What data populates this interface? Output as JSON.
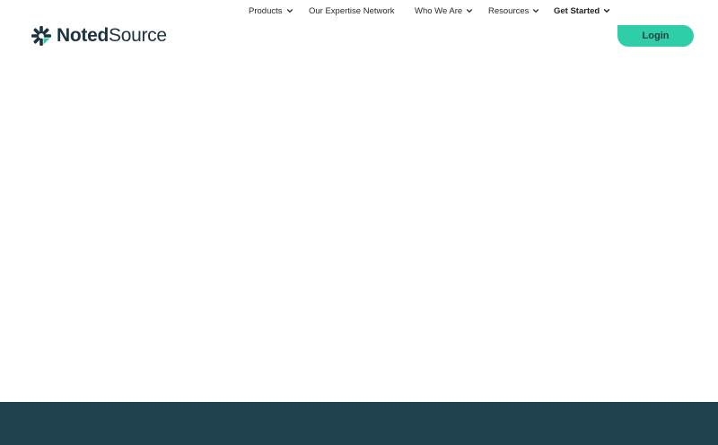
{
  "brand": {
    "logo_icon": "asterisk-logo-icon",
    "name_bold": "Noted",
    "name_regular": "Source",
    "color_text": "#1c3340"
  },
  "nav": {
    "items": [
      {
        "label": "Products",
        "has_dropdown": true
      },
      {
        "label": "Our Expertise Network",
        "has_dropdown": false
      },
      {
        "label": "Who We Are",
        "has_dropdown": true
      },
      {
        "label": "Resources",
        "has_dropdown": true
      },
      {
        "label": "Get Started",
        "has_dropdown": true
      }
    ],
    "chevron_icon": "chevron-down-icon"
  },
  "login": {
    "label": "Login",
    "color_bg": "#2ecfa8",
    "color_text": "#1d3a45"
  },
  "footer": {
    "color_bg": "#20424f"
  }
}
